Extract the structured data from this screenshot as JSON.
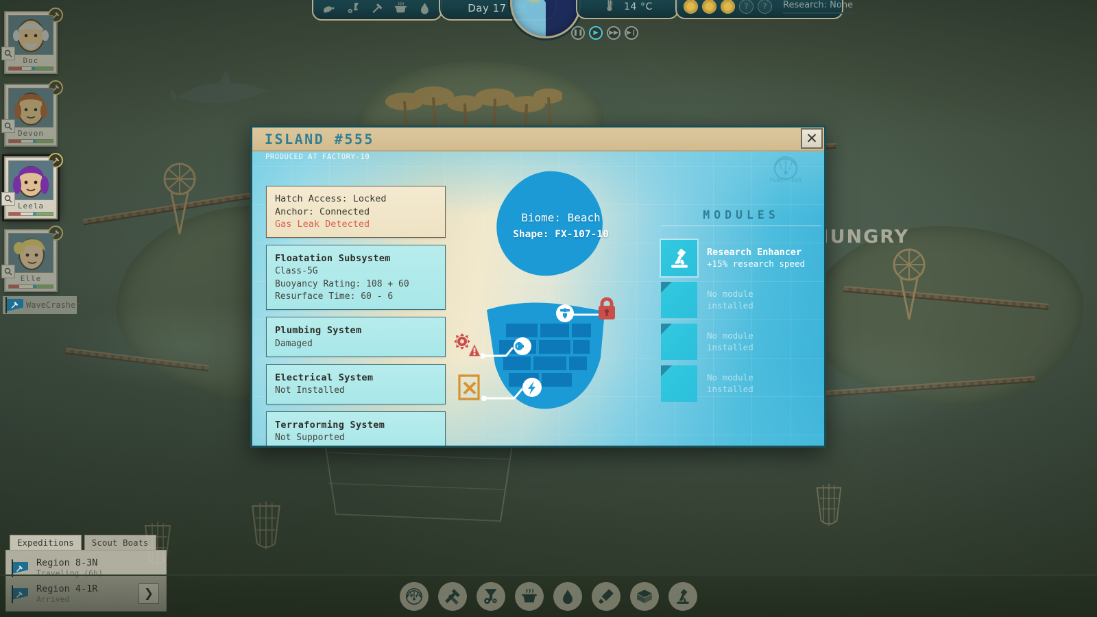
{
  "hud": {
    "day_label": "Day 17",
    "calendar_icon": "calendar-icon",
    "temperature": "14 °C",
    "thermometer_icon": "thermometer-icon",
    "research_label": "Research: None",
    "flask_icon": "flask-icon",
    "resource_icons": [
      "food-icon",
      "tools-icon",
      "hammer-icon",
      "cooking-pot-icon",
      "water-drop-icon"
    ],
    "research_slots": [
      "filled",
      "filled",
      "filled",
      "empty",
      "empty"
    ],
    "speed_buttons": [
      {
        "name": "pause-button",
        "glyph": "❚❚",
        "active": false
      },
      {
        "name": "play-button",
        "glyph": "▶",
        "active": true
      },
      {
        "name": "fast-forward-button",
        "glyph": "▶▶",
        "active": false
      },
      {
        "name": "ultra-speed-button",
        "glyph": "▶❚",
        "active": false
      }
    ],
    "daynight_dial": "day-night-dial"
  },
  "crew": [
    {
      "name": "Doc",
      "hair": "#cfcfcf",
      "skin": "#e3c18c",
      "selected": false
    },
    {
      "name": "Devon",
      "hair": "#a65a28",
      "skin": "#e0bb83",
      "selected": false
    },
    {
      "name": "Leela",
      "hair": "#7b2fa8",
      "skin": "#e8c49a",
      "selected": true
    },
    {
      "name": "Elle",
      "hair": "#e0c463",
      "skin": "#e8c49a",
      "selected": false
    }
  ],
  "boat_label": "WaveCrasher",
  "background_status_text": "HUNGRY",
  "expeditions": {
    "tabs": [
      {
        "label": "Expeditions",
        "active": true
      },
      {
        "label": "Scout Boats",
        "active": false
      }
    ],
    "rows": [
      {
        "title": "Region 8-3N",
        "status": "Traveling (6h)",
        "has_go": false
      },
      {
        "title": "Region 4-1R",
        "status": "Arrived",
        "has_go": true
      }
    ],
    "go_glyph": "❯"
  },
  "toolbar": {
    "buttons": [
      "float-tec-logo-icon",
      "hammer-tools-icon",
      "machinery-icon",
      "cooking-pot-icon",
      "water-drop-icon",
      "shovel-icon",
      "crate-icon",
      "microscope-icon"
    ],
    "float_tec_label": "FLOAT-TEC"
  },
  "dialog": {
    "title": "ISLAND #555",
    "subtitle": "PRODUCED AT FACTORY-10",
    "close_label": "✕",
    "watermark_label": "FLOAT-TECH",
    "panels": [
      {
        "style": "cream",
        "lines": [
          {
            "text": "Hatch Access: Locked",
            "style": "normal"
          },
          {
            "text": "Anchor: Connected",
            "style": "normal"
          },
          {
            "text": "Gas Leak Detected",
            "style": "alert"
          }
        ]
      },
      {
        "style": "aqua",
        "heading": "Floatation Subsystem",
        "lines": [
          {
            "text": "Class-5G",
            "style": "normal"
          },
          {
            "text": "Buoyancy Rating: 108 + 60",
            "style": "normal"
          },
          {
            "text": "Resurface Time: 60 - 6",
            "style": "normal"
          }
        ]
      },
      {
        "style": "aqua",
        "heading": "Plumbing System",
        "lines": [
          {
            "text": "Damaged",
            "style": "alert"
          }
        ]
      },
      {
        "style": "aqua",
        "heading": "Electrical System",
        "lines": [
          {
            "text": "Not Installed",
            "style": "normal"
          }
        ]
      },
      {
        "style": "aqua",
        "heading": "Terraforming System",
        "lines": [
          {
            "text": "Not Supported",
            "style": "normal"
          }
        ]
      }
    ],
    "island": {
      "biome_line": "Biome: Beach",
      "shape_line": "Shape: FX-107-10",
      "markers": [
        {
          "name": "hatch-marker",
          "icon": "hatch-icon",
          "status_icon": "lock-icon",
          "status_color": "#c9504a"
        },
        {
          "name": "plumbing-marker",
          "icon": "pipe-icon",
          "status_icon": "damaged-warning-icon",
          "status_color": "#c9504a"
        },
        {
          "name": "electrical-marker",
          "icon": "bolt-icon",
          "status_icon": "not-installed-icon",
          "status_color": "#d9922f"
        }
      ]
    },
    "modules": {
      "title": "MODULES",
      "empty_line1": "No module",
      "empty_line2": "installed",
      "slots": [
        {
          "installed": true,
          "icon": "microscope-icon",
          "name": "Research Enhancer",
          "desc": "+15% research speed"
        },
        {
          "installed": false
        },
        {
          "installed": false
        },
        {
          "installed": false
        }
      ]
    }
  },
  "colors": {
    "dialog_border": "#1a4f58",
    "title_bar": "#d6bf93",
    "title_text": "#2f7f93",
    "alert_red": "#d8604f",
    "module_cyan": "#2bbfdb",
    "island_blue": "#1b9ad6",
    "panel_cream": "#f1e6ca",
    "panel_aqua": "#b0e9ea"
  }
}
